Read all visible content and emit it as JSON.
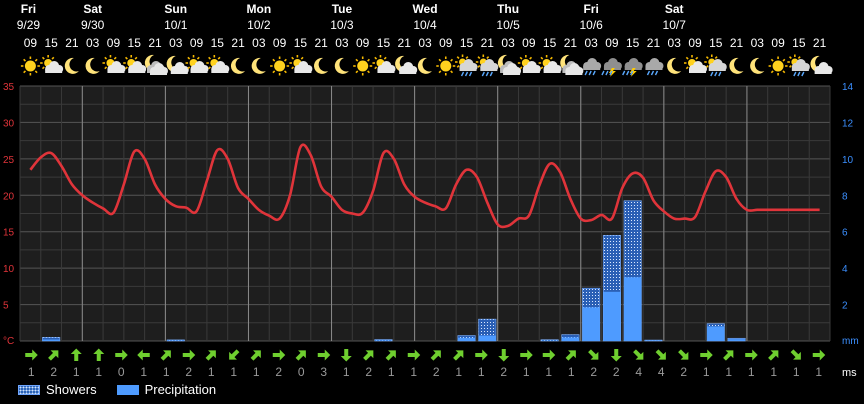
{
  "chart_data": {
    "type": "bar+line",
    "days": [
      {
        "name": "Fri",
        "date": "9/29"
      },
      {
        "name": "Sat",
        "date": "9/30"
      },
      {
        "name": "Sun",
        "date": "10/1"
      },
      {
        "name": "Mon",
        "date": "10/2"
      },
      {
        "name": "Tue",
        "date": "10/3"
      },
      {
        "name": "Wed",
        "date": "10/4"
      },
      {
        "name": "Thu",
        "date": "10/5"
      },
      {
        "name": "Fri",
        "date": "10/6"
      },
      {
        "name": "Sat",
        "date": "10/7"
      }
    ],
    "hours": [
      "09",
      "15",
      "21",
      "03",
      "09",
      "15",
      "21",
      "03",
      "09",
      "15",
      "21",
      "03",
      "09",
      "15",
      "21",
      "03",
      "09",
      "15",
      "21",
      "03",
      "09",
      "15",
      "21",
      "03",
      "09",
      "15",
      "21",
      "03",
      "09",
      "15",
      "21",
      "03",
      "09",
      "15",
      "21",
      "03",
      "09",
      "15",
      "21"
    ],
    "weather_icons": [
      "sun",
      "partly-cloudy-day",
      "moon",
      "moon",
      "partly-cloudy-day",
      "partly-cloudy-day",
      "cloudy-night",
      "partly-cloudy-night",
      "partly-cloudy-day",
      "partly-cloudy-day",
      "moon",
      "moon",
      "sun",
      "partly-cloudy-day",
      "moon",
      "moon",
      "sun",
      "partly-cloudy-day",
      "partly-cloudy-night",
      "moon",
      "sun",
      "rain-day",
      "rain-day",
      "cloudy-night",
      "partly-cloudy-day",
      "partly-cloudy-day",
      "cloudy-night",
      "rain",
      "thunder",
      "thunder",
      "rain",
      "moon",
      "partly-cloudy-day",
      "rain-day",
      "moon",
      "moon",
      "sun",
      "rain-day",
      "partly-cloudy-night"
    ],
    "temperature": {
      "name": "",
      "unit": "°C",
      "color": "#e0343a",
      "x": [
        0,
        0.5,
        1,
        1.5,
        2,
        2.5,
        3,
        3.5,
        4,
        4.5,
        5,
        5.5,
        6,
        6.5,
        7,
        7.5,
        8,
        8.5,
        9,
        9.5,
        10,
        10.5,
        11,
        11.5,
        12,
        12.5,
        13,
        13.5,
        14,
        14.5,
        15,
        15.5,
        16,
        16.5,
        17,
        17.5,
        18,
        18.5,
        19,
        19.5,
        20,
        20.5,
        21,
        21.5,
        22,
        22.5,
        23,
        23.5,
        24,
        24.5,
        25,
        25.5,
        26,
        26.5,
        27,
        27.5,
        28,
        28.5,
        29,
        29.5,
        30,
        30.5,
        31,
        31.5,
        32,
        32.5,
        33,
        33.5,
        34,
        34.5,
        35,
        35.5,
        36,
        36.5,
        37,
        37.5,
        38
      ],
      "y": [
        23.5,
        25.2,
        25.8,
        24,
        21.5,
        20,
        19,
        18.2,
        17.6,
        21.5,
        26,
        25,
        21.5,
        19.5,
        18.5,
        18.3,
        17.8,
        22,
        26.2,
        25,
        21,
        19.5,
        18,
        17.2,
        16.8,
        20,
        26.6,
        25.5,
        21.2,
        19.8,
        18,
        17.5,
        17.6,
        20.6,
        25.8,
        25,
        21.5,
        19.8,
        19,
        18.5,
        18.2,
        21.5,
        23.5,
        22.5,
        19,
        16,
        15.8,
        16.8,
        17.2,
        21.3,
        24.3,
        23.2,
        19.5,
        16.8,
        16.6,
        17.3,
        16.8,
        21,
        23,
        22.4,
        19.3,
        17.8,
        16.8,
        16.8,
        17,
        20.5,
        23.3,
        22.5,
        19.5,
        18,
        18,
        18,
        18,
        18,
        18,
        18,
        18
      ]
    },
    "precipitation": {
      "name": "Precipitation",
      "unit": "mm",
      "color": "#4e9bff",
      "values": [
        0,
        0.1,
        0,
        0,
        0,
        0,
        0,
        0,
        0,
        0,
        0,
        0,
        0,
        0,
        0,
        0,
        0,
        0,
        0,
        0,
        0,
        0.15,
        0.1,
        0,
        0,
        0,
        0,
        0,
        0,
        0,
        0,
        0.05,
        0,
        0.9,
        2.7,
        0,
        0,
        0,
        0,
        0,
        0,
        0,
        0.25,
        0.05,
        0,
        0,
        0,
        0,
        0,
        0,
        0,
        0,
        0,
        0,
        0,
        0,
        0.55,
        1.35,
        0,
        0,
        0,
        0,
        0,
        0,
        0,
        0,
        0,
        0,
        0,
        0,
        0,
        0,
        0,
        0,
        0,
        0,
        0,
        0,
        0,
        0,
        0,
        0.35,
        1.8,
        0,
        0,
        0,
        0,
        0,
        0,
        0,
        0
      ]
    },
    "showers_total": {
      "name": "Showers",
      "color": "#2a63b8",
      "values": [
        0,
        0.15,
        0,
        0,
        0,
        0,
        0,
        0,
        0,
        0,
        0,
        0,
        0,
        0,
        0,
        0,
        0,
        0,
        0,
        0,
        0,
        0.6,
        2.9,
        0,
        0,
        0,
        0,
        0,
        0,
        0,
        0,
        0.15,
        0.15,
        1.1,
        3.5,
        0,
        0,
        0,
        0,
        0,
        0,
        0,
        0.3,
        0.2,
        0,
        0,
        0,
        0,
        0,
        0,
        0,
        0,
        0,
        0,
        0,
        0,
        0.7,
        1.4,
        0,
        0,
        0,
        0,
        0,
        0,
        0,
        0,
        0,
        0,
        0,
        0,
        0,
        0,
        0,
        0,
        0,
        0,
        0,
        0,
        0,
        0,
        0,
        0.4,
        2.2,
        0,
        0,
        0,
        0,
        0,
        0,
        0,
        0
      ]
    },
    "bars": [
      {
        "i": 1,
        "shower": 0.2,
        "precip": 0.08
      },
      {
        "i": 7,
        "shower": 0.06,
        "precip": 0.03
      },
      {
        "i": 17,
        "shower": 0.08,
        "precip": 0.04
      },
      {
        "i": 21,
        "shower": 0.3,
        "precip": 0.18
      },
      {
        "i": 22,
        "shower": 1.2,
        "precip": 0.3
      },
      {
        "i": 25,
        "shower": 0.07,
        "precip": 0.03
      },
      {
        "i": 26,
        "shower": 0.35,
        "precip": 0.2
      },
      {
        "i": 27,
        "shower": 2.9,
        "precip": 1.85
      },
      {
        "i": 28,
        "shower": 5.8,
        "precip": 2.7
      },
      {
        "i": 29,
        "shower": 7.7,
        "precip": 3.5
      },
      {
        "i": 30,
        "shower": 0.05,
        "precip": 0.03
      },
      {
        "i": 33,
        "shower": 0.95,
        "precip": 0.8
      },
      {
        "i": 34,
        "shower": 0.15,
        "precip": 0.1
      }
    ],
    "y_left": {
      "ticks": [
        0,
        5,
        10,
        15,
        20,
        25,
        30,
        35
      ],
      "min": 0,
      "max": 35,
      "unit": "°C"
    },
    "y_right": {
      "ticks": [
        0,
        2,
        4,
        6,
        8,
        10,
        12,
        14
      ],
      "min": 0,
      "max": 14,
      "unit": "mm"
    },
    "wind": {
      "unit": "ms",
      "color": "#6fcf2f",
      "directions": [
        "E",
        "NE",
        "N",
        "N",
        "E",
        "W",
        "NE",
        "E",
        "NE",
        "SW",
        "NE",
        "E",
        "NE",
        "E",
        "S",
        "NE",
        "NE",
        "E",
        "NE",
        "NE",
        "E",
        "S",
        "E",
        "E",
        "NE",
        "SE",
        "S",
        "SE",
        "SE",
        "SE",
        "E",
        "NE",
        "E",
        "NE",
        "SE",
        "E"
      ],
      "speeds": [
        1,
        2,
        1,
        1,
        0,
        1,
        1,
        2,
        1,
        1,
        1,
        2,
        0,
        3,
        1,
        2,
        1,
        1,
        2,
        1,
        1,
        2,
        1,
        1,
        1,
        2,
        2,
        4,
        4,
        2,
        1,
        1,
        1,
        1,
        1,
        1
      ]
    },
    "legend": [
      {
        "label": "Showers",
        "style": "showers"
      },
      {
        "label": "Precipitation",
        "style": "precip"
      }
    ],
    "grid": true
  }
}
